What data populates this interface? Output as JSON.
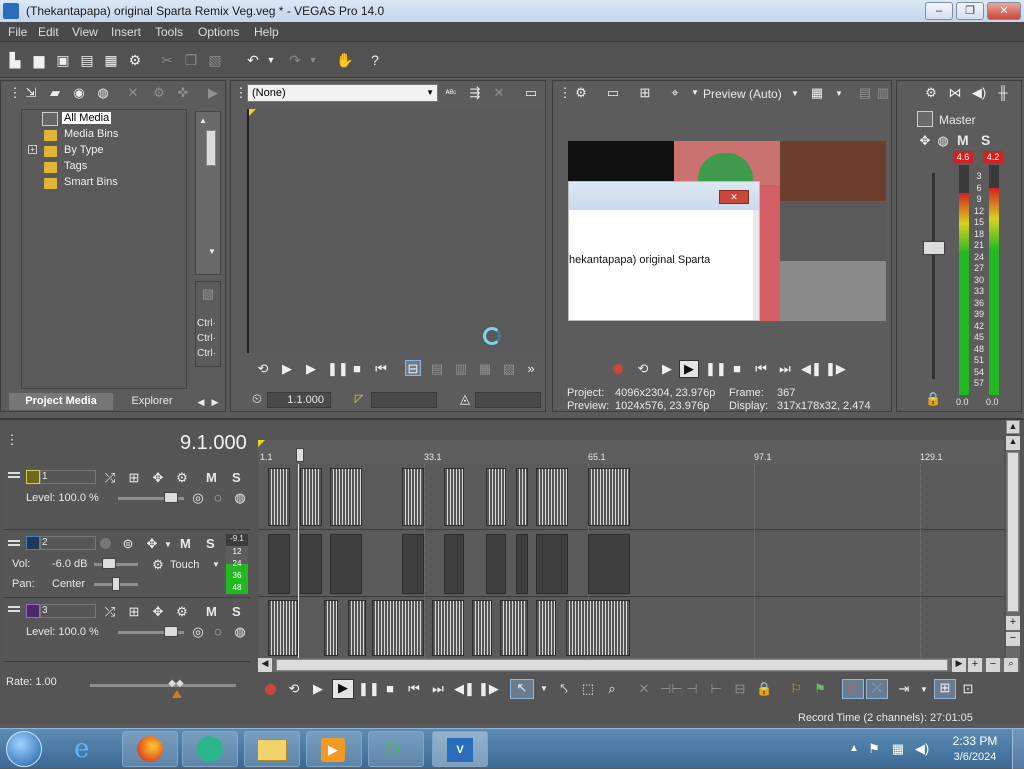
{
  "window": {
    "title": "(Thekantapapa) original Sparta Remix Veg.veg * - VEGAS Pro 14.0",
    "minimize": "‒",
    "maximize": "❐",
    "close": "✕"
  },
  "menu": [
    "File",
    "Edit",
    "View",
    "Insert",
    "Tools",
    "Options",
    "Help"
  ],
  "project_media": {
    "tree": [
      "All Media",
      "Media Bins",
      "By Type",
      "Tags",
      "Smart Bins"
    ],
    "tabs": [
      "Project Media",
      "Explorer"
    ],
    "side_labels": [
      "Ctrl·",
      "Ctrl·",
      "Ctrl·"
    ]
  },
  "trimmer": {
    "select_value": "(None)",
    "timecode": "1.1.000"
  },
  "preview": {
    "mode": "Preview (Auto)",
    "dialog_text": "hekantapapa) original Sparta",
    "project_label": "Project:",
    "project_value": "4096x2304, 23.976p",
    "preview_label": "Preview:",
    "preview_value": "1024x576, 23.976p",
    "frame_label": "Frame:",
    "frame_value": "367",
    "display_label": "Display:",
    "display_value": "317x178x32, 2.474"
  },
  "master": {
    "label": "Master",
    "mute": "M",
    "solo": "S",
    "peak_left": "4.6",
    "peak_right": "4.2",
    "scale": [
      "3",
      "6",
      "9",
      "12",
      "15",
      "18",
      "21",
      "24",
      "27",
      "30",
      "33",
      "36",
      "39",
      "42",
      "45",
      "48",
      "51",
      "54",
      "57"
    ],
    "level_left": "0.0",
    "level_right": "0.0",
    "meter_left_fill": 0.88,
    "meter_right_fill": 0.9
  },
  "timeline": {
    "cursor_time": "9.1.000",
    "ruler": [
      "1.1",
      "33.1",
      "65.1",
      "97.1",
      "129.1"
    ],
    "tracks": [
      {
        "number": "1",
        "type": "video",
        "level_label": "Level: 100.0 %"
      },
      {
        "number": "2",
        "type": "audio",
        "vol_label": "Vol:",
        "vol_value": "-6.0 dB",
        "pan_label": "Pan:",
        "pan_value": "Center",
        "mode": "Touch",
        "meter_peak": "-9.1",
        "meter_scale": [
          "12",
          "24",
          "36",
          "48"
        ]
      },
      {
        "number": "3",
        "type": "video",
        "level_label": "Level: 100.0 %"
      }
    ],
    "mute": "M",
    "solo": "S",
    "rate": "Rate: 1.00",
    "record_time": "Record Time (2 channels): 27:01:05"
  },
  "taskbar": {
    "time": "2:33 PM",
    "date": "3/6/2024"
  },
  "colors": {
    "meter_green": "#22b822",
    "meter_yellow": "#d8d21e",
    "meter_red": "#d42020",
    "accent_blue": "#2a6ebb"
  }
}
